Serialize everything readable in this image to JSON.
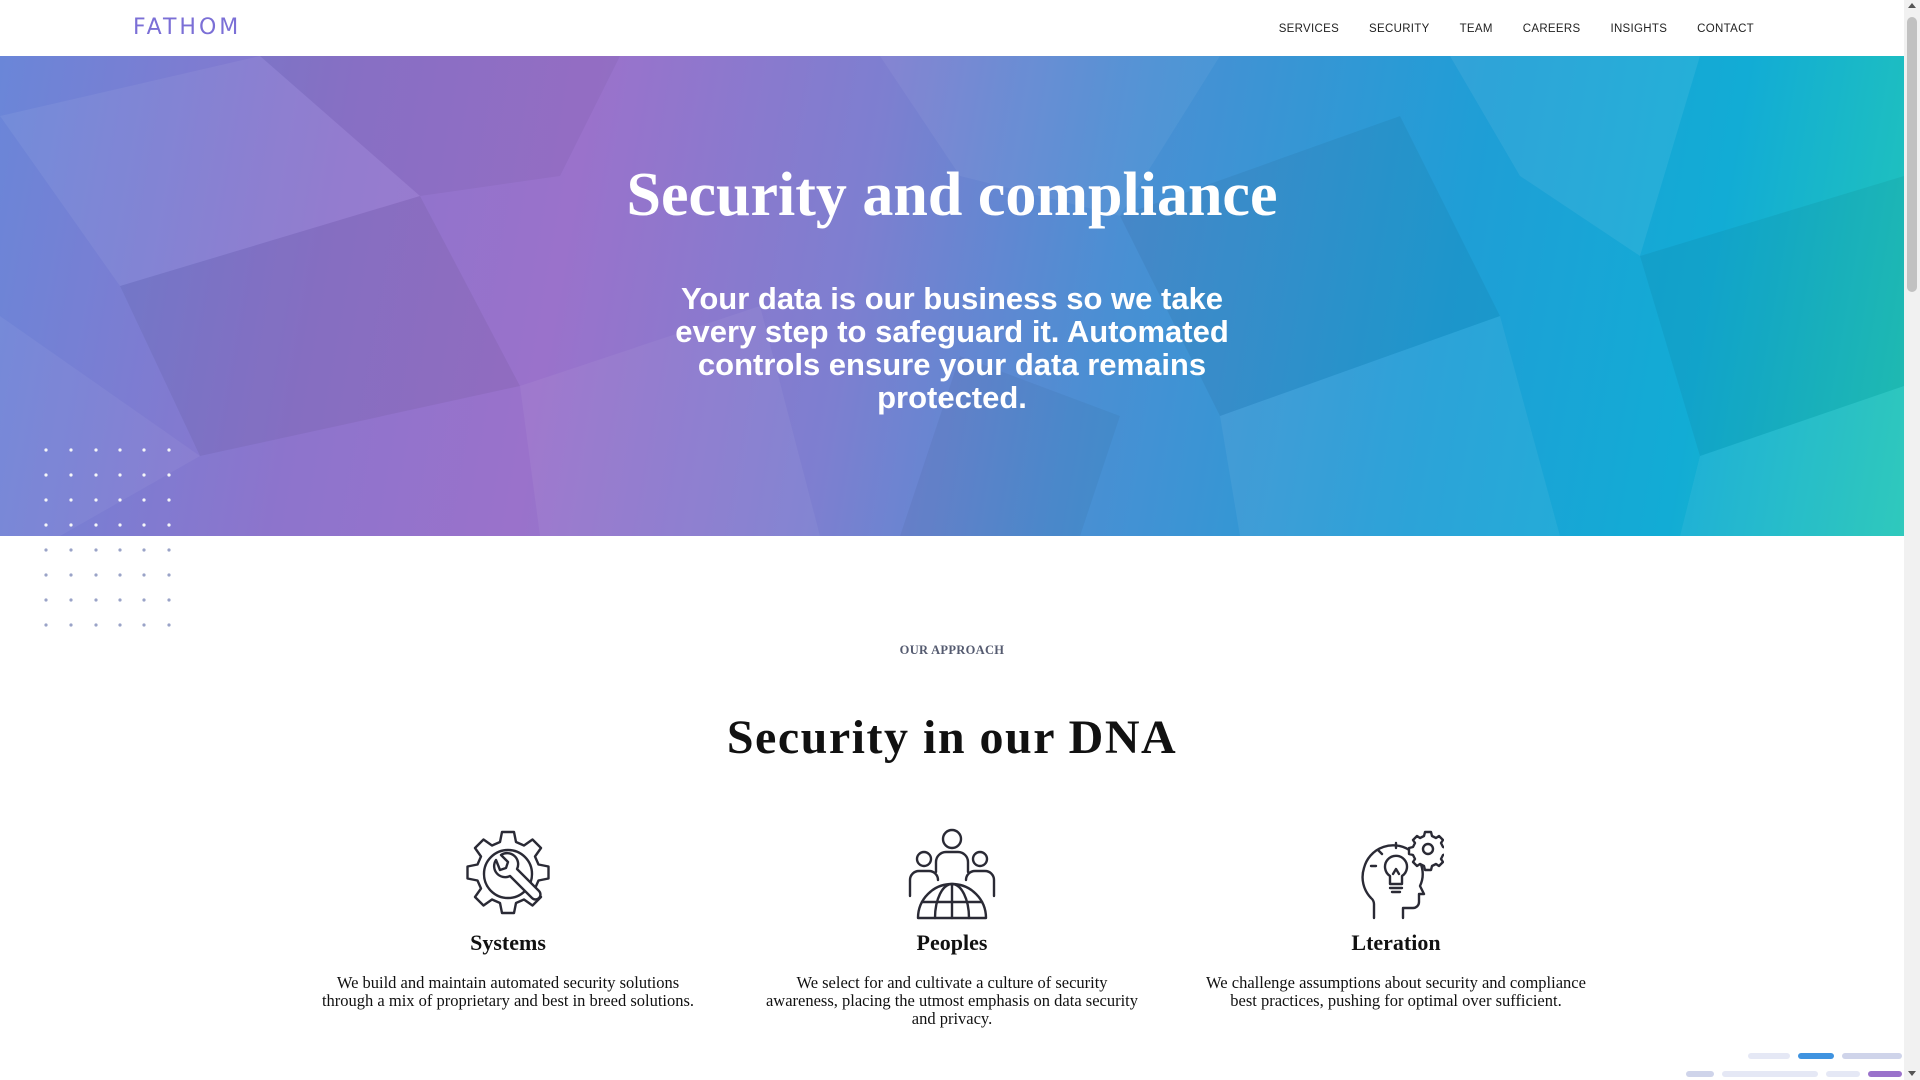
{
  "brand": {
    "logo": "FATHOM"
  },
  "nav": [
    {
      "label": "SERVICES"
    },
    {
      "label": "SECURITY"
    },
    {
      "label": "TEAM"
    },
    {
      "label": "CAREERS"
    },
    {
      "label": "INSIGHTS"
    },
    {
      "label": "CONTACT"
    }
  ],
  "hero": {
    "title": "Security and compliance",
    "subtitle": "Your data is our business so we take every step to safeguard it. Automated controls ensure your data remains protected."
  },
  "approach": {
    "eyebrow": "OUR APPROACH",
    "title": "Security in our DNA",
    "features": [
      {
        "icon": "gear-wrench-icon",
        "title": "Systems",
        "text": "We build and maintain automated security solutions through a mix of proprietary and best in breed solutions."
      },
      {
        "icon": "people-globe-icon",
        "title": "Peoples",
        "text": "We select for and cultivate a culture of security awareness, placing the utmost emphasis on data security and privacy."
      },
      {
        "icon": "head-lightbulb-gear-icon",
        "title": "Lteration",
        "text": "We challenge assumptions about security and compliance best practices, pushing for optimal over sufficient."
      }
    ]
  },
  "colors": {
    "accent": "#7b6fd6",
    "hero_gradient_start": "#6a86d8",
    "hero_gradient_mid": "#9a72cb",
    "hero_gradient_end": "#22c6b8"
  }
}
